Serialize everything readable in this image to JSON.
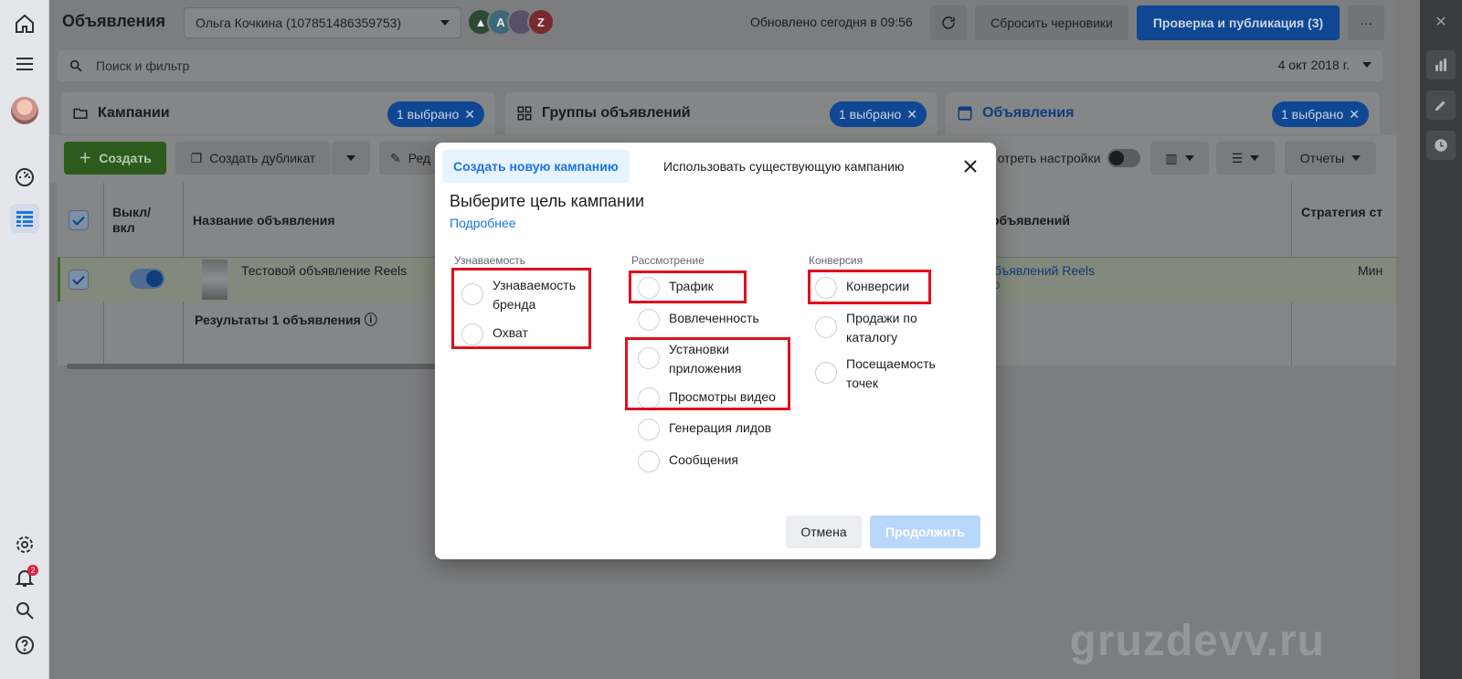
{
  "app": {
    "title": "Объявления",
    "account": "Ольга Кочкина (107851486359753)",
    "updated": "Обновлено сегодня в 09:56",
    "reset_drafts": "Сбросить черновики",
    "publish": "Проверка и публикация (3)",
    "more": "···",
    "avatars": [
      "A",
      "Z"
    ]
  },
  "search": {
    "placeholder": "Поиск и фильтр",
    "date": "4 окт 2018 г."
  },
  "levels": {
    "campaigns": {
      "label": "Кампании",
      "chip": "1 выбрано"
    },
    "adsets": {
      "label": "Группы объявлений",
      "chip": "1 выбрано"
    },
    "ads": {
      "label": "Объявления",
      "chip": "1 выбрано"
    }
  },
  "toolbar": {
    "create": "Создать",
    "duplicate": "Создать дубликат",
    "edit": "Ред",
    "view_settings": "отреть настройки",
    "reports": "Отчеты"
  },
  "table": {
    "col_toggle": "Выкл/вкл",
    "col_name": "Название объявления",
    "col_adset": "объявлений",
    "col_strategy": "Стратегия ст",
    "row_name": "Тестовой объявление Reels",
    "row_adset": "бъявлений Reels",
    "row_adset_sub": "0",
    "row_strategy": "Мин",
    "results": "Результаты 1 объявления"
  },
  "dialog": {
    "tab_new": "Создать новую кампанию",
    "tab_existing": "Использовать существующую кампанию",
    "title": "Выберите цель кампании",
    "learn_more": "Подробнее",
    "columns": [
      {
        "title": "Узнаваемость",
        "options": [
          "Узнаваемость бренда",
          "Охват"
        ]
      },
      {
        "title": "Рассмотрение",
        "options": [
          "Трафик",
          "Вовлеченность",
          "Установки приложения",
          "Просмотры видео",
          "Генерация лидов",
          "Сообщения"
        ]
      },
      {
        "title": "Конверсия",
        "options": [
          "Конверсии",
          "Продажи по каталогу",
          "Посещаемость точек"
        ]
      }
    ],
    "cancel": "Отмена",
    "continue": "Продолжить"
  },
  "notifications_badge": "2",
  "watermark": "gruzdevv.ru",
  "colors": {
    "accent": "#1b74e4",
    "highlight": "#e0101e",
    "create_green": "#42b72a"
  }
}
